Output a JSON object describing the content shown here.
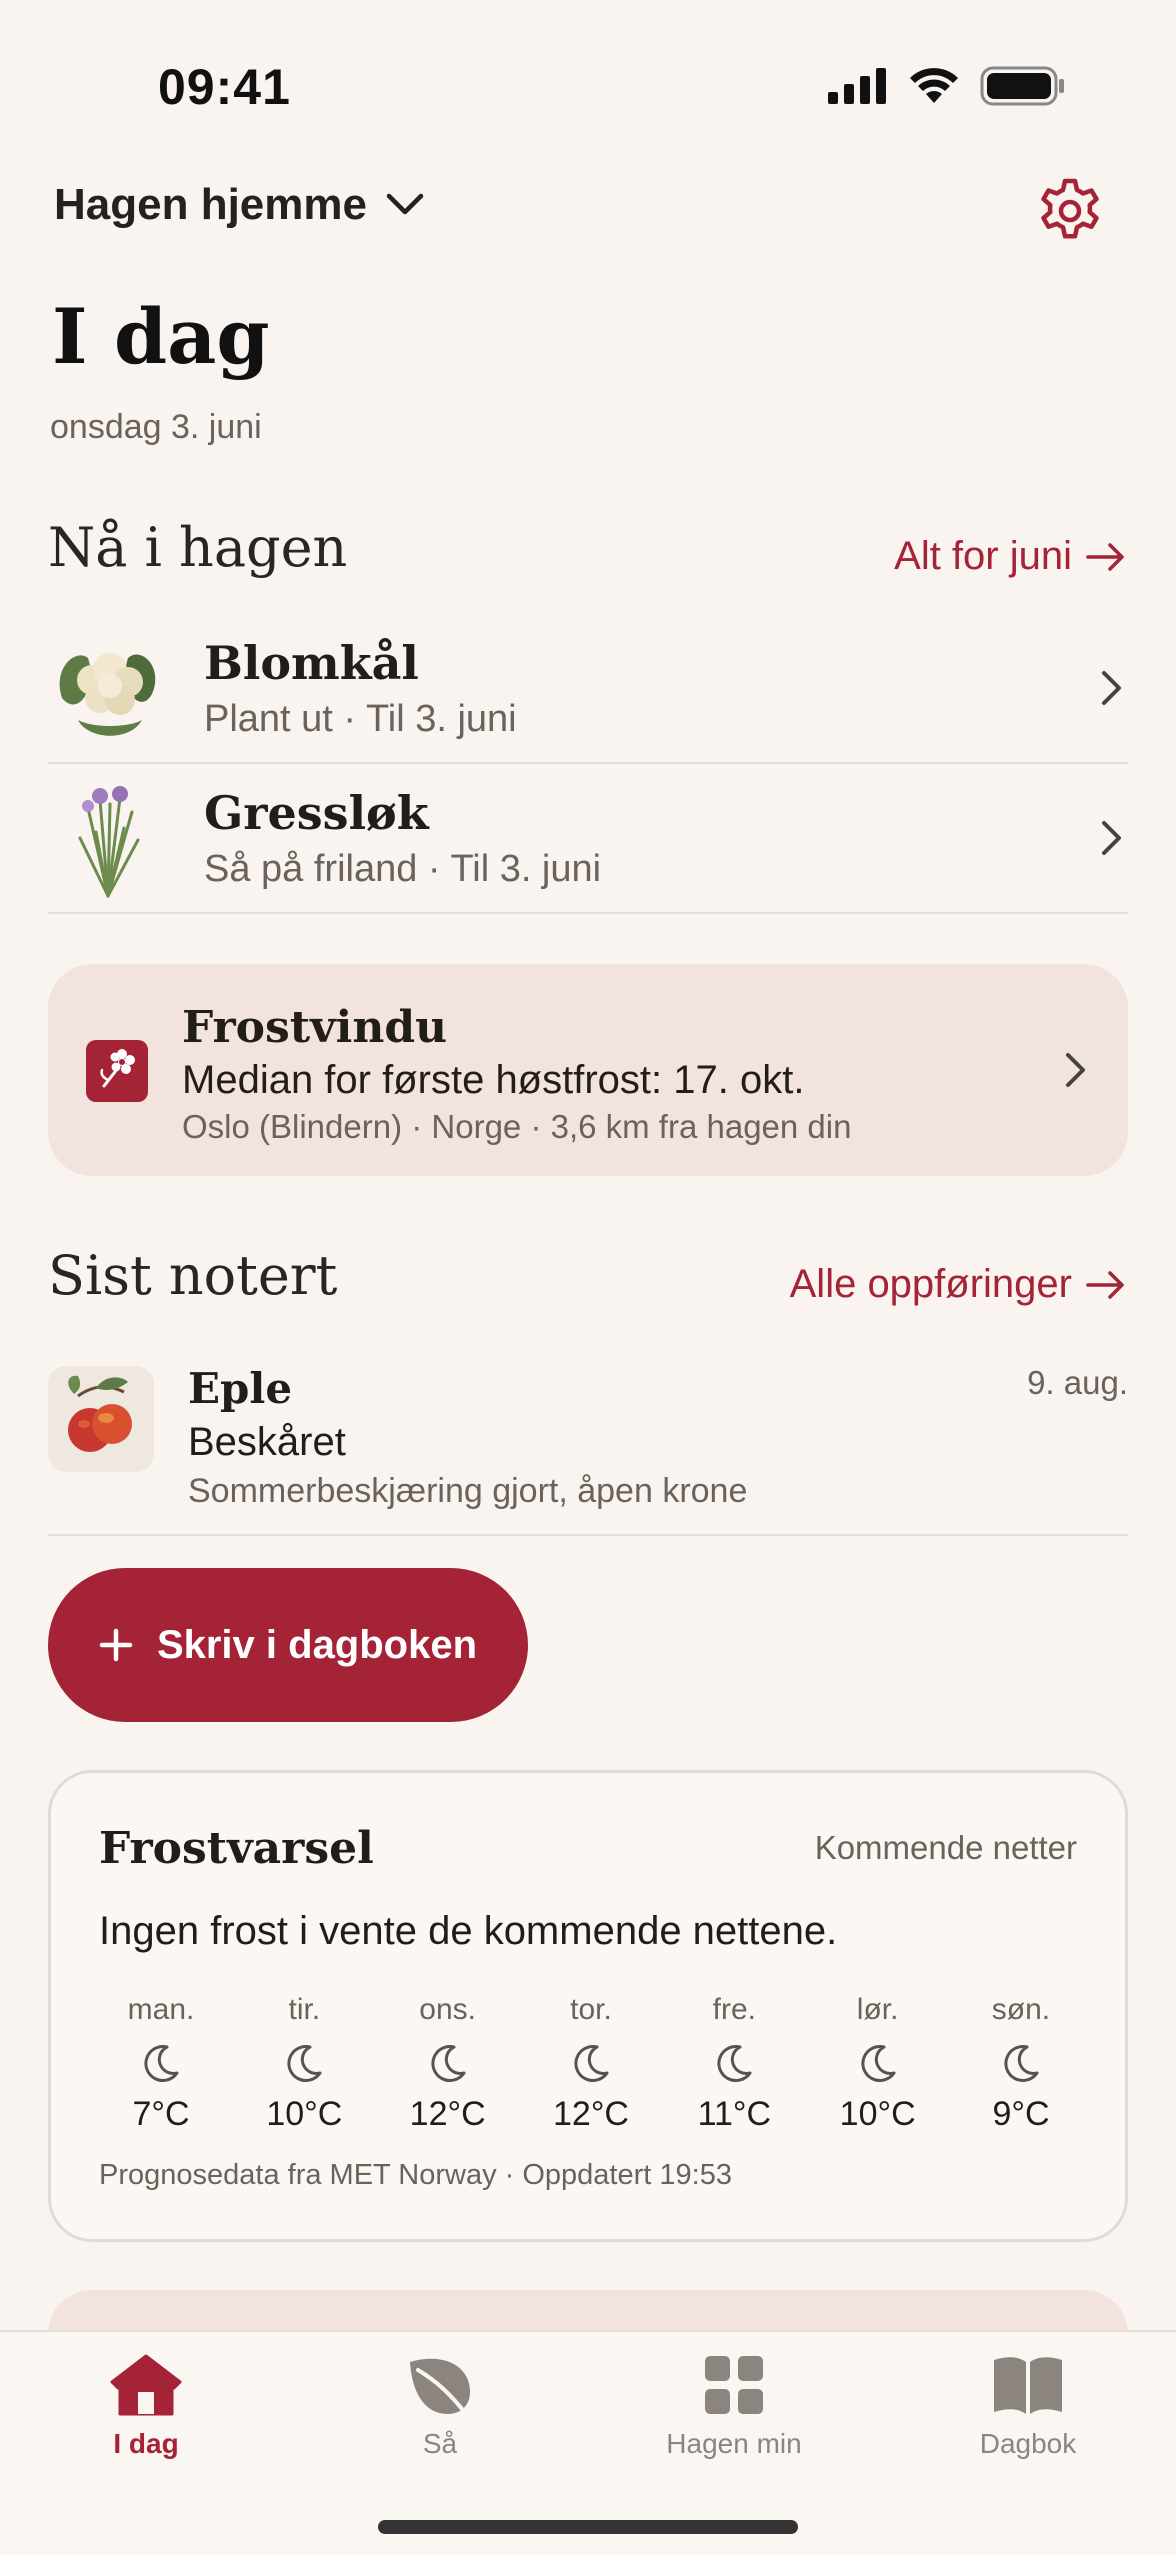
{
  "status_bar": {
    "time": "09:41"
  },
  "header": {
    "garden_name": "Hagen hjemme",
    "title": "I dag",
    "date": "onsdag 3. juni"
  },
  "now_in_garden": {
    "title": "Nå i hagen",
    "link": "Alt for juni",
    "items": [
      {
        "name": "Blomkål",
        "subtitle": "Plant ut · Til 3. juni",
        "icon": "cauliflower-icon"
      },
      {
        "name": "Gressløk",
        "subtitle": "Så på friland · Til 3. juni",
        "icon": "chives-icon"
      }
    ]
  },
  "frost_window": {
    "title": "Frostvindu",
    "main": "Median for første høstfrost: 17. okt.",
    "sub": "Oslo (Blindern) · Norge · 3,6 km fra hagen din"
  },
  "recent": {
    "title": "Sist notert",
    "link": "Alle oppføringer",
    "entry": {
      "plant": "Eple",
      "action": "Beskåret",
      "detail": "Sommerbeskjæring gjort, åpen krone",
      "date": "9. aug."
    }
  },
  "diary_button": {
    "label": "Skriv i dagboken"
  },
  "forecast": {
    "title": "Frostvarsel",
    "range": "Kommende netter",
    "summary": "Ingen frost i vente de kommende nettene.",
    "days": [
      {
        "day": "man.",
        "temp": "7°C"
      },
      {
        "day": "tir.",
        "temp": "10°C"
      },
      {
        "day": "ons.",
        "temp": "12°C"
      },
      {
        "day": "tor.",
        "temp": "12°C"
      },
      {
        "day": "fre.",
        "temp": "11°C"
      },
      {
        "day": "lør.",
        "temp": "10°C"
      },
      {
        "day": "søn.",
        "temp": "9°C"
      }
    ],
    "source": "Prognosedata fra MET Norway · Oppdatert 19:53"
  },
  "tabs": [
    {
      "label": "I dag",
      "icon": "home-icon",
      "active": true
    },
    {
      "label": "Så",
      "icon": "leaf-icon",
      "active": false
    },
    {
      "label": "Hagen min",
      "icon": "grid-icon",
      "active": false
    },
    {
      "label": "Dagbok",
      "icon": "book-icon",
      "active": false
    }
  ],
  "colors": {
    "accent": "#a42337",
    "background": "#f9f4ef",
    "card_pink": "#f2e3df"
  }
}
